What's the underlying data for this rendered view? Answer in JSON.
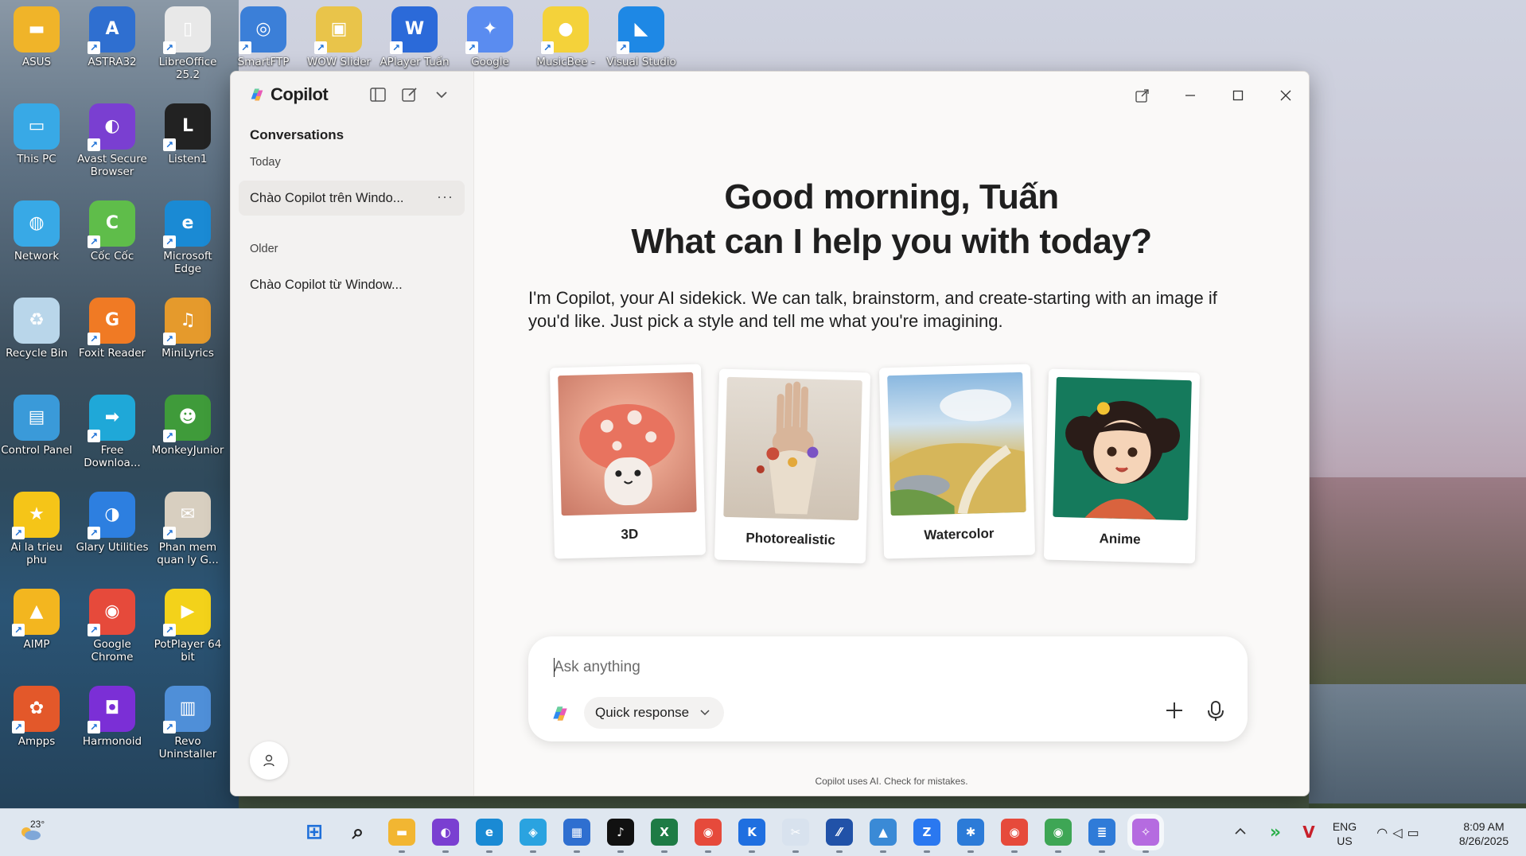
{
  "desktop": {
    "icons": [
      {
        "label": "ASUS",
        "name": "desktop-icon-asus",
        "color": "#f0b429",
        "glyph": "▬"
      },
      {
        "label": "ASTRA32",
        "name": "desktop-icon-astra32",
        "color": "#2f6fd0",
        "glyph": "A"
      },
      {
        "label": "LibreOffice 25.2",
        "name": "desktop-icon-libreoffice",
        "color": "#e8e8e8",
        "glyph": "▯"
      },
      {
        "label": "SmartFTP",
        "name": "desktop-icon-smartftp",
        "color": "#3b7fd8",
        "glyph": "◎"
      },
      {
        "label": "WOW Slider",
        "name": "desktop-icon-wow-slider",
        "color": "#e9c44a",
        "glyph": "▣"
      },
      {
        "label": "APlayer Tuấn",
        "name": "desktop-icon-aplayer",
        "color": "#2b6ad9",
        "glyph": "W"
      },
      {
        "label": "Google",
        "name": "desktop-icon-google",
        "color": "#5a8cf0",
        "glyph": "✦"
      },
      {
        "label": "MusicBee -",
        "name": "desktop-icon-musicbee",
        "color": "#f4d23a",
        "glyph": "●"
      },
      {
        "label": "Visual Studio",
        "name": "desktop-icon-visual-studio",
        "color": "#1e88e5",
        "glyph": "◣"
      },
      {
        "label": "This PC",
        "name": "desktop-icon-this-pc",
        "color": "#38a9e6",
        "glyph": "▭"
      },
      {
        "label": "Avast Secure Browser",
        "name": "desktop-icon-avast",
        "color": "#7a3fd1",
        "glyph": "◐"
      },
      {
        "label": "Listen1",
        "name": "desktop-icon-listen1",
        "color": "#222222",
        "glyph": "L"
      },
      {
        "label": "Network",
        "name": "desktop-icon-network",
        "color": "#38a9e6",
        "glyph": "◍"
      },
      {
        "label": "Cốc Cốc",
        "name": "desktop-icon-coccoc",
        "color": "#5fbd4a",
        "glyph": "C"
      },
      {
        "label": "Microsoft Edge",
        "name": "desktop-icon-edge",
        "color": "#1a8ad4",
        "glyph": "e"
      },
      {
        "label": "Recycle Bin",
        "name": "desktop-icon-recycle-bin",
        "color": "#b9d6ea",
        "glyph": "♻"
      },
      {
        "label": "Foxit Reader",
        "name": "desktop-icon-foxit",
        "color": "#f07a24",
        "glyph": "G"
      },
      {
        "label": "MiniLyrics",
        "name": "desktop-icon-minilyrics",
        "color": "#e59a2c",
        "glyph": "♫"
      },
      {
        "label": "Control Panel",
        "name": "desktop-icon-control-panel",
        "color": "#3a9ad9",
        "glyph": "▤"
      },
      {
        "label": "Free Downloa...",
        "name": "desktop-icon-free-download",
        "color": "#1fa8d8",
        "glyph": "➡"
      },
      {
        "label": "MonkeyJunior",
        "name": "desktop-icon-monkeyjunior",
        "color": "#3f9b3a",
        "glyph": "☻"
      },
      {
        "label": "Ai la trieu phu",
        "name": "desktop-icon-ai-la-trieu-phu",
        "color": "#f5c518",
        "glyph": "★"
      },
      {
        "label": "Glary Utilities",
        "name": "desktop-icon-glary",
        "color": "#2d7fe0",
        "glyph": "◑"
      },
      {
        "label": "Phan mem quan ly G...",
        "name": "desktop-icon-phan-mem",
        "color": "#d8cfc0",
        "glyph": "✉"
      },
      {
        "label": "AIMP",
        "name": "desktop-icon-aimp",
        "color": "#f3b61f",
        "glyph": "▲"
      },
      {
        "label": "Google Chrome",
        "name": "desktop-icon-chrome",
        "color": "#e64a3b",
        "glyph": "◉"
      },
      {
        "label": "PotPlayer 64 bit",
        "name": "desktop-icon-potplayer",
        "color": "#f3d21a",
        "glyph": "▶"
      },
      {
        "label": "Ampps",
        "name": "desktop-icon-ampps",
        "color": "#e3582a",
        "glyph": "✿"
      },
      {
        "label": "Harmonoid",
        "name": "desktop-icon-harmonoid",
        "color": "#7b2fd6",
        "glyph": "◘"
      },
      {
        "label": "Revo Uninstaller",
        "name": "desktop-icon-revo",
        "color": "#4f8fd8",
        "glyph": "▥"
      }
    ]
  },
  "copilot": {
    "brand": "Copilot",
    "sidebar": {
      "heading": "Conversations",
      "today_label": "Today",
      "older_label": "Older",
      "today_items": [
        "Chào Copilot trên Windo..."
      ],
      "older_items": [
        "Chào Copilot từ Window..."
      ],
      "more_label": "···"
    },
    "main": {
      "greeting_line1": "Good morning, Tuấn",
      "greeting_line2": "What can I help you with today?",
      "intro": "I'm Copilot, your AI sidekick. We can talk, brainstorm, and create-starting with an image if you'd like. Just pick a style and tell me what you're imagining.",
      "styles": [
        "3D",
        "Photorealistic",
        "Watercolor",
        "Anime"
      ],
      "composer": {
        "placeholder": "Ask anything",
        "mode_label": "Quick response"
      },
      "disclaimer": "Copilot uses AI. Check for mistakes."
    }
  },
  "taskbar": {
    "weather": "23°",
    "language": "ENG",
    "region": "US",
    "time": "8:09 AM",
    "date": "8/26/2025",
    "apps": [
      {
        "name": "taskbar-start",
        "color": "#1e6fd9",
        "glyph": "⊞"
      },
      {
        "name": "taskbar-search",
        "color": "#2b2b2b",
        "glyph": "⌕"
      },
      {
        "name": "taskbar-file-explorer",
        "color": "#f2b632",
        "glyph": "▬"
      },
      {
        "name": "taskbar-avast",
        "color": "#7a3fd1",
        "glyph": "◐"
      },
      {
        "name": "taskbar-edge",
        "color": "#1a8ad4",
        "glyph": "e"
      },
      {
        "name": "taskbar-app-blue",
        "color": "#2aa3e0",
        "glyph": "◈"
      },
      {
        "name": "taskbar-store",
        "color": "#2f6fd0",
        "glyph": "▦"
      },
      {
        "name": "taskbar-tiktok",
        "color": "#111111",
        "glyph": "♪"
      },
      {
        "name": "taskbar-excel",
        "color": "#1e7b45",
        "glyph": "X"
      },
      {
        "name": "taskbar-chrome",
        "color": "#e64a3b",
        "glyph": "◉"
      },
      {
        "name": "taskbar-k-app",
        "color": "#1f6fe0",
        "glyph": "K"
      },
      {
        "name": "taskbar-snipping",
        "color": "#d8e2ee",
        "glyph": "✂"
      },
      {
        "name": "taskbar-app-vv",
        "color": "#2152a8",
        "glyph": "⁄⁄"
      },
      {
        "name": "taskbar-photos",
        "color": "#3a8ad6",
        "glyph": "▲"
      },
      {
        "name": "taskbar-zalo",
        "color": "#2a78f0",
        "glyph": "Z"
      },
      {
        "name": "taskbar-app-gear",
        "color": "#2c7bd8",
        "glyph": "✱"
      },
      {
        "name": "taskbar-chrome-2",
        "color": "#e64a3b",
        "glyph": "◉"
      },
      {
        "name": "taskbar-chrome-3",
        "color": "#3ea655",
        "glyph": "◉"
      },
      {
        "name": "taskbar-notepad",
        "color": "#2f7bd8",
        "glyph": "≣"
      },
      {
        "name": "taskbar-copilot",
        "color": "#b56be0",
        "glyph": "✧"
      }
    ]
  },
  "colors": {
    "window_bg": "#f3f2f1",
    "main_bg": "#faf9f8",
    "taskbar_bg": "#dfe7f0"
  }
}
